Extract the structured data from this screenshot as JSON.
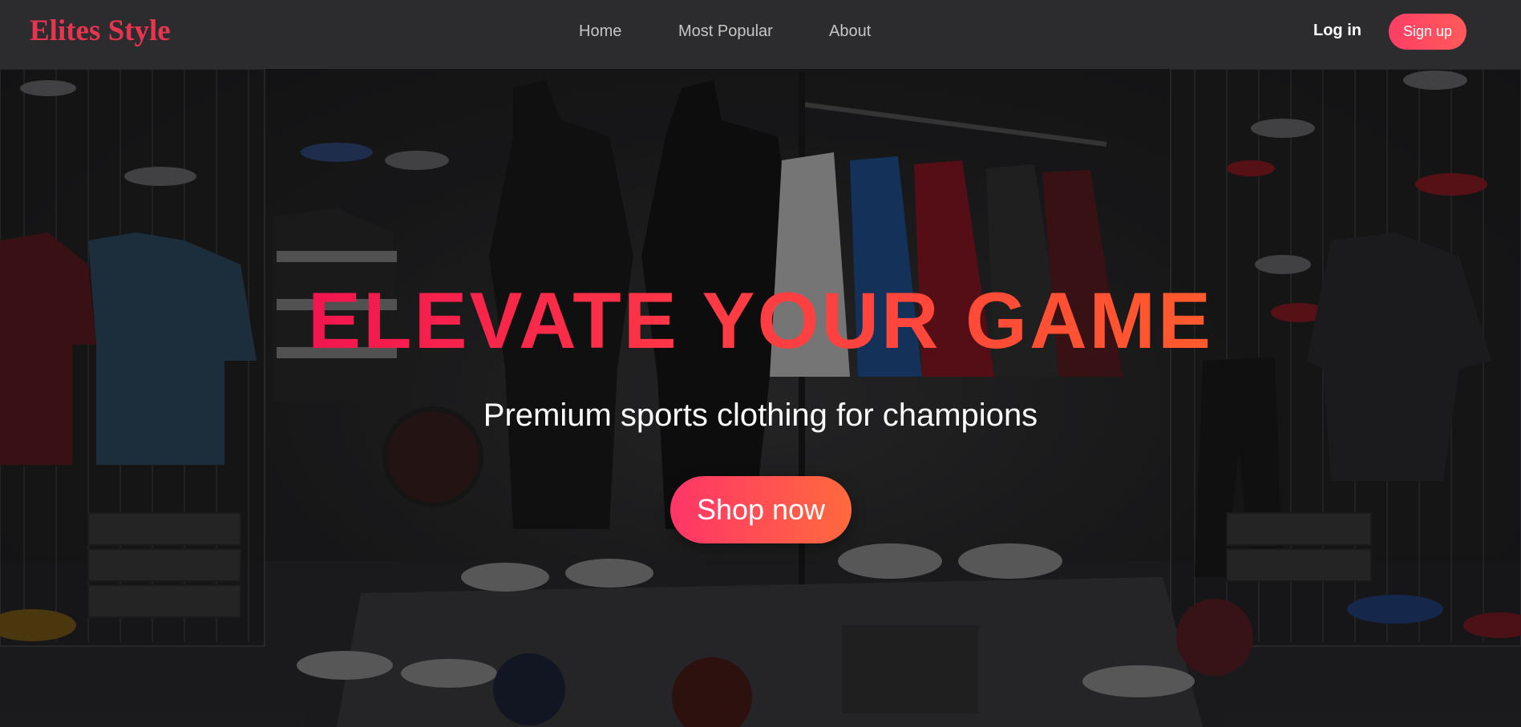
{
  "navbar": {
    "brand": "Elites Style",
    "links": [
      {
        "label": "Home"
      },
      {
        "label": "Most Popular"
      },
      {
        "label": "About"
      }
    ],
    "login_label": "Log in",
    "signup_label": "Sign up"
  },
  "hero": {
    "title": "ELEVATE YOUR GAME",
    "subtitle": "Premium sports clothing for champions",
    "cta_label": "Shop now"
  },
  "colors": {
    "brand": "#e8354f",
    "accent_start": "#ff3568",
    "accent_end": "#ff6a3d",
    "navbar_bg": "#2e2e30"
  }
}
